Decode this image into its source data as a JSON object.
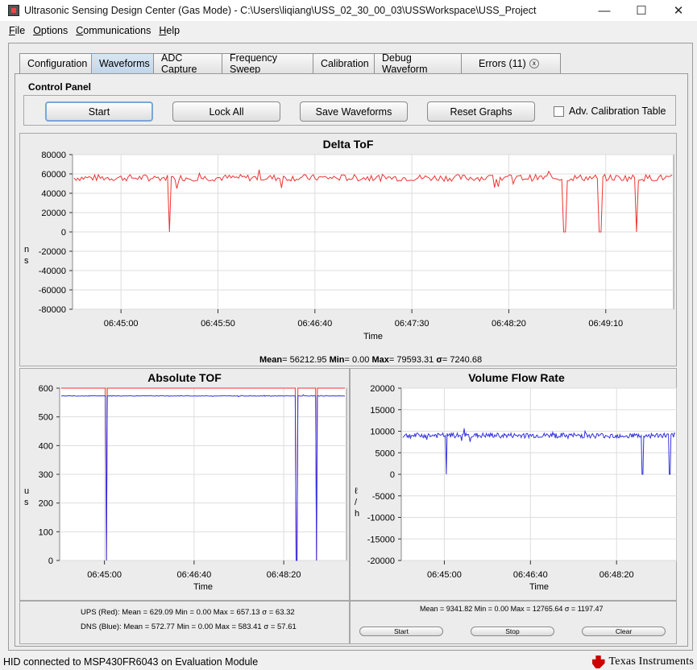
{
  "window": {
    "title": "Ultrasonic Sensing Design Center (Gas Mode) - C:\\Users\\liqiang\\USS_02_30_00_03\\USSWorkspace\\USS_Project",
    "min": "—",
    "max": "☐",
    "close": "✕"
  },
  "menu": [
    "File",
    "Options",
    "Communications",
    "Help"
  ],
  "tabs": [
    "Configuration",
    "Waveforms",
    "ADC Capture",
    "Frequency Sweep",
    "Calibration",
    "Debug Waveform",
    "Errors (11)"
  ],
  "tab_close": "x",
  "control_panel": {
    "title": "Control Panel",
    "start": "Start",
    "lock_all": "Lock All",
    "save_waveforms": "Save Waveforms",
    "reset_graphs": "Reset Graphs",
    "adv_calibration": "Adv. Calibration Table",
    "adv_calibration_checked": false
  },
  "delta_tof": {
    "stats": {
      "mean_label": "Mean",
      "mean": "= 56212.95",
      "min_label": "Min",
      "min": "= 0.00",
      "max_label": "Max",
      "max": "= 79593.31",
      "sigma_label": "σ",
      "sigma": "= 7240.68"
    }
  },
  "absolute_tof": {
    "ups_stats": "UPS (Red): Mean = 629.09 Min = 0.00 Max = 657.13 σ = 63.32",
    "dns_stats": "DNS (Blue): Mean = 572.77 Min = 0.00 Max = 583.41 σ = 57.61"
  },
  "volume_flow": {
    "stats": "Mean = 9341.82 Min = 0.00 Max = 12765.64 σ = 1197.47",
    "start": "Start",
    "stop": "Stop",
    "clear": "Clear"
  },
  "chart_data": [
    {
      "type": "line",
      "title": "Delta ToF",
      "xlabel": "Time",
      "ylabel": "n s",
      "x_ticks": [
        "06:45:00",
        "06:45:50",
        "06:46:40",
        "06:47:30",
        "06:48:20",
        "06:49:10"
      ],
      "y_ticks": [
        "80000",
        "60000",
        "40000",
        "20000",
        "0",
        "-20000",
        "-40000",
        "-60000",
        "-80000"
      ],
      "ylim": [
        -80000,
        80000
      ],
      "series": [
        {
          "color": "#ee3333",
          "baseline": 56000,
          "noise": 7000,
          "dips": [
            0.16,
            0.82,
            0.88,
            0.94
          ]
        }
      ],
      "grid": true
    },
    {
      "type": "line",
      "title": "Absolute TOF",
      "xlabel": "Time",
      "ylabel": "u s",
      "x_ticks": [
        "06:45:00",
        "06:46:40",
        "06:48:20"
      ],
      "y_ticks": [
        "600",
        "500",
        "400",
        "300",
        "200",
        "100",
        "0"
      ],
      "ylim": [
        0,
        600
      ],
      "series": [
        {
          "color": "#ee3333",
          "baseline": 629,
          "noise": 3,
          "dips": [
            0.16,
            0.83,
            0.9
          ]
        },
        {
          "color": "#3333ee",
          "baseline": 573,
          "noise": 2,
          "dips": [
            0.16,
            0.83,
            0.9
          ]
        }
      ],
      "grid": true
    },
    {
      "type": "line",
      "title": "Volume Flow Rate",
      "xlabel": "Time",
      "ylabel": "ℓ / h",
      "x_ticks": [
        "06:45:00",
        "06:46:40",
        "06:48:20"
      ],
      "y_ticks": [
        "20000",
        "15000",
        "10000",
        "5000",
        "0",
        "-5000",
        "-10000",
        "-15000",
        "-20000"
      ],
      "ylim": [
        -20000,
        20000
      ],
      "series": [
        {
          "color": "#3333dd",
          "baseline": 9000,
          "noise": 1200,
          "dips": [
            0.16,
            0.88,
            0.98
          ]
        }
      ],
      "grid": true
    }
  ],
  "status": {
    "text": "HID connected to MSP430FR6043 on Evaluation Module",
    "brand": "Texas Instruments"
  }
}
